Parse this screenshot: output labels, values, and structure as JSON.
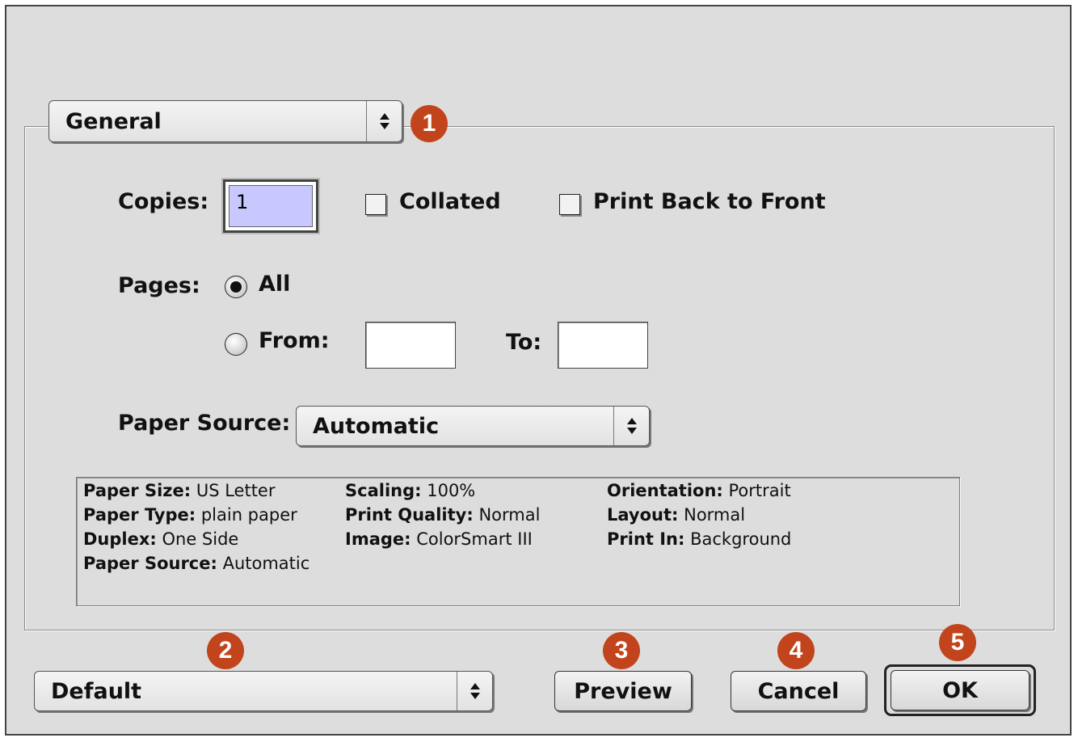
{
  "dialog": {
    "panel_popup": {
      "value": "General",
      "badge": "1"
    },
    "copies": {
      "label": "Copies:",
      "value": "1"
    },
    "collated": {
      "label": "Collated",
      "checked": false
    },
    "back_to_front": {
      "label": "Print Back to Front",
      "checked": false
    },
    "pages": {
      "label": "Pages:",
      "all_label": "All",
      "from_label": "From:",
      "to_label": "To:",
      "from_value": "",
      "to_value": "",
      "selected": "All"
    },
    "paper_source": {
      "label": "Paper Source:",
      "value": "Automatic"
    },
    "summary": {
      "paper_size": {
        "key": "Paper Size:",
        "value": "US Letter"
      },
      "paper_type": {
        "key": "Paper Type:",
        "value": "plain paper"
      },
      "duplex": {
        "key": "Duplex:",
        "value": "One Side"
      },
      "paper_source": {
        "key": "Paper Source:",
        "value": "Automatic"
      },
      "scaling": {
        "key": "Scaling:",
        "value": "100%"
      },
      "print_quality": {
        "key": "Print Quality:",
        "value": "Normal"
      },
      "image": {
        "key": "Image:",
        "value": "ColorSmart III"
      },
      "orientation": {
        "key": "Orientation:",
        "value": "Portrait"
      },
      "layout": {
        "key": "Layout:",
        "value": "Normal"
      },
      "print_in": {
        "key": "Print In:",
        "value": "Background"
      }
    },
    "settings_popup": {
      "value": "Default",
      "badge": "2"
    },
    "preview_button": {
      "label": "Preview",
      "badge": "3"
    },
    "cancel_button": {
      "label": "Cancel",
      "badge": "4"
    },
    "ok_button": {
      "label": "OK",
      "badge": "5"
    },
    "colors": {
      "badge": "#c2441c",
      "field_highlight": "#c8c8ff",
      "dialog_bg": "#dddddd"
    }
  }
}
